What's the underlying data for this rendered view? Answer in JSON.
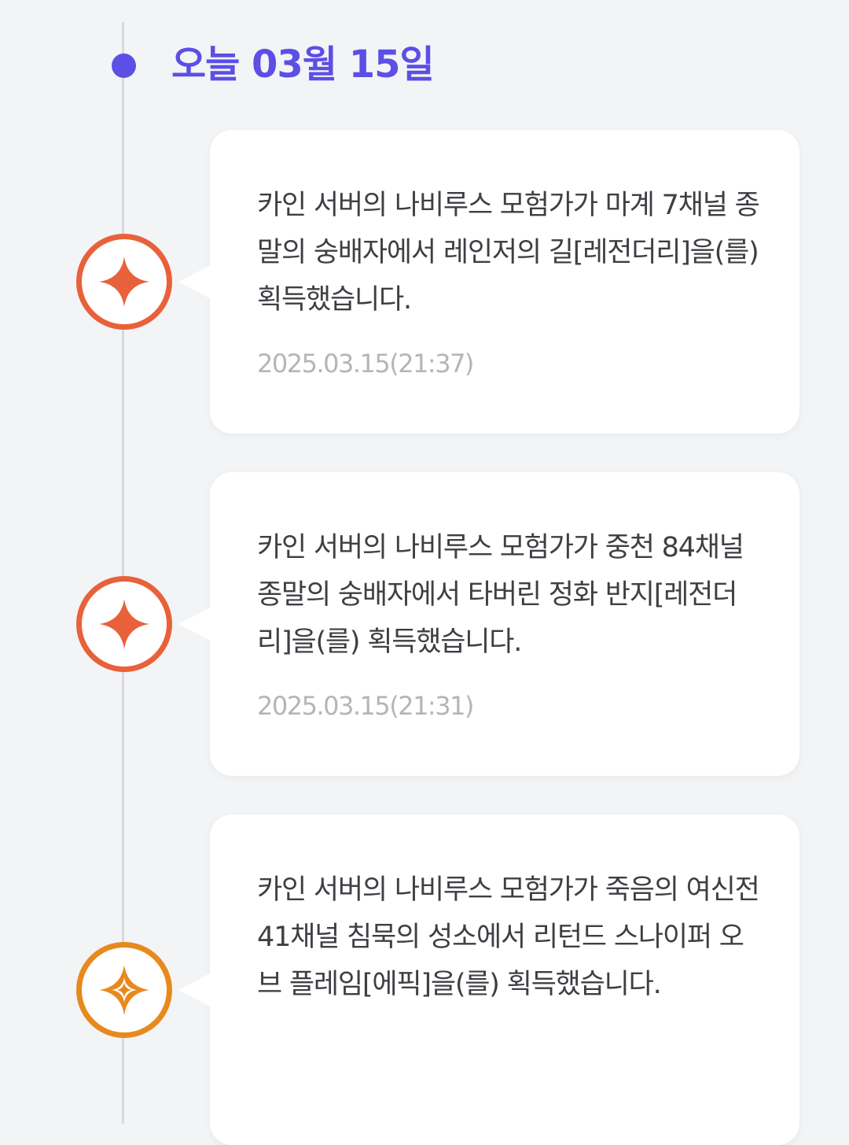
{
  "date_header": "오늘 03월 15일",
  "colors": {
    "accent": "#5b4fe6",
    "legendary": "#e8613a",
    "epic": "#e8891e",
    "timestamp": "#b3b5b9"
  },
  "entries": [
    {
      "grade": "legendary",
      "icon": "legendary-star-icon",
      "message": "카인 서버의 나비루스 모험가가 마계 7채널 종말의 숭배자에서 레인저의 길[레전더리]을(를) 획득했습니다.",
      "time": "2025.03.15(21:37)"
    },
    {
      "grade": "legendary",
      "icon": "legendary-star-icon",
      "message": "카인 서버의 나비루스 모험가가 중천 84채널 종말의 숭배자에서 타버린 정화 반지[레전더리]을(를) 획득했습니다.",
      "time": "2025.03.15(21:31)"
    },
    {
      "grade": "epic",
      "icon": "epic-star-icon",
      "message": "카인 서버의 나비루스 모험가가 죽음의 여신전 41채널 침묵의 성소에서 리턴드 스나이퍼 오브 플레임[에픽]을(를) 획득했습니다."
    }
  ]
}
